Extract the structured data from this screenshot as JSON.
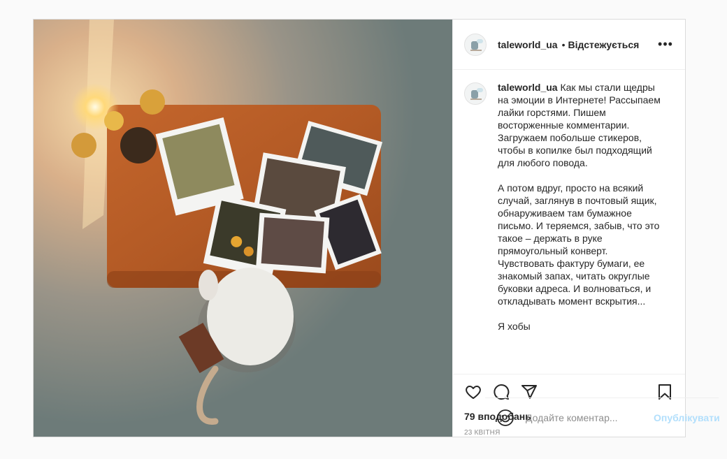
{
  "post": {
    "username": "taleworld_ua",
    "follow_status": "Відстежується",
    "more_icon": "more-horizontal-icon",
    "caption_username": "taleworld_ua",
    "caption_text": "Как мы стали щедры на эмоции в Интернете! Рассыпаем лайки горстями. Пишем восторженные комментарии. Загружаем побольше стикеров, чтобы в копилке был подходящий для любого повода.\n\nА потом вдруг, просто на всякий случай, заглянув в почтовый ящик, обнаруживаем там бумажное письмо. И теряемся, забыв, что это такое – держать в руке прямоугольный конверт. Чувствовать фактуру бумаги, ее знакомый запах, читать округлые буковки адреса. И волноваться, и откладывать момент вскрытия...\n\nЯ хобы",
    "likes": "79 вподобань",
    "date": "23 квітня"
  },
  "actions": {
    "like_icon": "heart-icon",
    "comment_icon": "comment-icon",
    "share_icon": "paper-plane-icon",
    "save_icon": "bookmark-icon"
  },
  "comment_box": {
    "emoji_icon": "smile-icon",
    "placeholder": "Додайте коментар...",
    "post_label": "Опублікувати"
  },
  "colors": {
    "post_link": "#b2dffc",
    "border": "#dbdbdb",
    "text": "#262626",
    "muted": "#8e8e8e"
  }
}
